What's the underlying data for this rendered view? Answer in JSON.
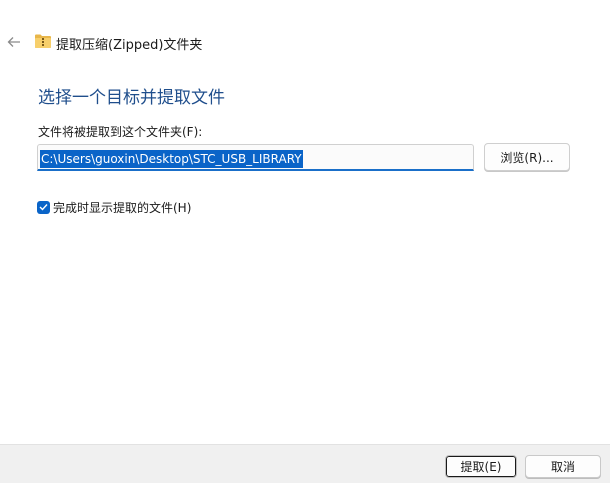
{
  "window": {
    "title": "提取压缩(Zipped)文件夹",
    "back_icon": "arrow-left-icon",
    "folder_icon": "zip-folder-icon"
  },
  "main": {
    "heading": "选择一个目标并提取文件",
    "folder_label": "文件将被提取到这个文件夹(F):",
    "path_value": "C:\\Users\\guoxin\\Desktop\\STC_USB_LIBRARY",
    "browse_label": "浏览(R)...",
    "show_files_checked": true,
    "show_files_label": "完成时显示提取的文件(H)"
  },
  "footer": {
    "extract_label": "提取(E)",
    "cancel_label": "取消"
  },
  "colors": {
    "accent": "#0a64c8",
    "heading": "#1f4e8c",
    "footer_bg": "#f0f0f0"
  }
}
